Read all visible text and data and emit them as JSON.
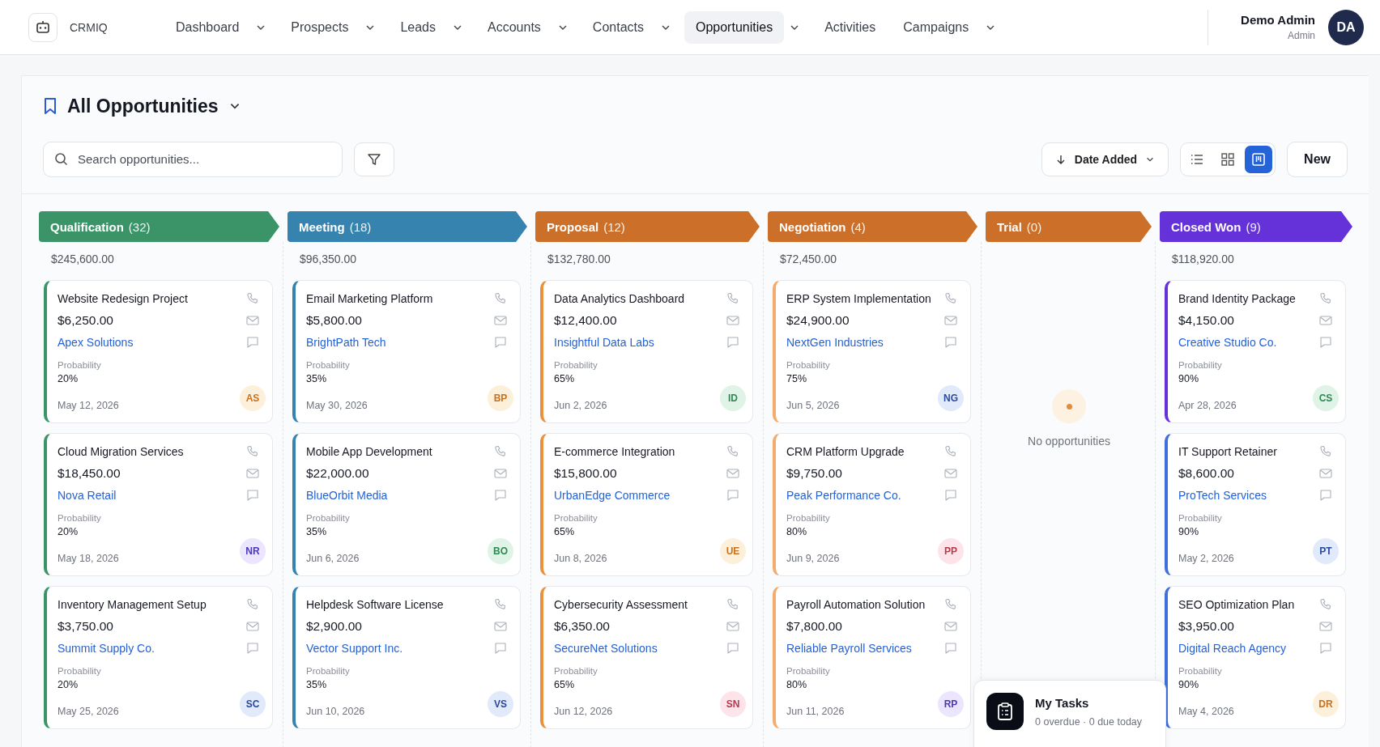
{
  "app": {
    "name": "CRMIQ"
  },
  "nav": [
    {
      "label": "Dashboard",
      "has_menu": true,
      "selected": false
    },
    {
      "label": "Prospects",
      "has_menu": true,
      "selected": false
    },
    {
      "label": "Leads",
      "has_menu": true,
      "selected": false
    },
    {
      "label": "Accounts",
      "has_menu": true,
      "selected": false
    },
    {
      "label": "Contacts",
      "has_menu": true,
      "selected": false
    },
    {
      "label": "Opportunities",
      "has_menu": true,
      "selected": true
    },
    {
      "label": "Activities",
      "has_menu": false,
      "selected": false
    },
    {
      "label": "Campaigns",
      "has_menu": true,
      "selected": false
    }
  ],
  "user": {
    "name": "Demo Admin",
    "role": "Admin",
    "initials": "DA"
  },
  "view_title": "All Opportunities",
  "search": {
    "placeholder": "Search opportunities..."
  },
  "sort": {
    "label": "Date Added"
  },
  "view_modes": [
    {
      "kind": "list",
      "selected": false
    },
    {
      "kind": "grid",
      "selected": false
    },
    {
      "kind": "kanban",
      "selected": true
    }
  ],
  "new_button": "New",
  "stages": [
    {
      "name": "Qualification",
      "count": "(32)",
      "color": "#3a9468",
      "total": "$245,600.00",
      "cards": [
        {
          "title": "Website Redesign Project",
          "amount": "$6,250.00",
          "company": "Apex Solutions",
          "probability_label": "Probability",
          "probability": "20%",
          "date": "May 12, 2026",
          "initials": "AS",
          "kind": "orange",
          "color": "#3a9468"
        },
        {
          "title": "Cloud Migration Services",
          "amount": "$18,450.00",
          "company": "Nova Retail",
          "probability_label": "Probability",
          "probability": "20%",
          "date": "May 18, 2026",
          "initials": "NR",
          "kind": "purple",
          "color": "#3a9468"
        },
        {
          "title": "Inventory Management Setup",
          "amount": "$3,750.00",
          "company": "Summit Supply Co.",
          "probability_label": "Probability",
          "probability": "20%",
          "date": "May 25, 2026",
          "initials": "SC",
          "kind": "blue",
          "color": "#3a9468"
        }
      ]
    },
    {
      "name": "Meeting",
      "count": "(18)",
      "color": "#3583ae",
      "total": "$96,350.00",
      "cards": [
        {
          "title": "Email Marketing Platform",
          "amount": "$5,800.00",
          "company": "BrightPath Tech",
          "probability_label": "Probability",
          "probability": "35%",
          "date": "May 30, 2026",
          "initials": "BP",
          "kind": "orange",
          "color": "#3583ae"
        },
        {
          "title": "Mobile App Development",
          "amount": "$22,000.00",
          "company": "BlueOrbit Media",
          "probability_label": "Probability",
          "probability": "35%",
          "date": "Jun 6, 2026",
          "initials": "BO",
          "kind": "green",
          "color": "#3583ae"
        },
        {
          "title": "Helpdesk Software License",
          "amount": "$2,900.00",
          "company": "Vector Support Inc.",
          "probability_label": "Probability",
          "probability": "35%",
          "date": "Jun 10, 2026",
          "initials": "VS",
          "kind": "blue",
          "color": "#3583ae"
        }
      ]
    },
    {
      "name": "Proposal",
      "count": "(12)",
      "color": "#cc6f28",
      "total": "$132,780.00",
      "cards": [
        {
          "title": "Data Analytics Dashboard",
          "amount": "$12,400.00",
          "company": "Insightful Data Labs",
          "probability_label": "Probability",
          "probability": "65%",
          "date": "Jun 2, 2026",
          "initials": "ID",
          "kind": "green",
          "color": "#e8913f"
        },
        {
          "title": "E-commerce Integration",
          "amount": "$15,800.00",
          "company": "UrbanEdge Commerce",
          "probability_label": "Probability",
          "probability": "65%",
          "date": "Jun 8, 2026",
          "initials": "UE",
          "kind": "orange",
          "color": "#e8913f"
        },
        {
          "title": "Cybersecurity Assessment",
          "amount": "$6,350.00",
          "company": "SecureNet Solutions",
          "probability_label": "Probability",
          "probability": "65%",
          "date": "Jun 12, 2026",
          "initials": "SN",
          "kind": "pink",
          "color": "#e8913f"
        }
      ]
    },
    {
      "name": "Negotiation",
      "count": "(4)",
      "color": "#cc6f28",
      "total": "$72,450.00",
      "cards": [
        {
          "title": "ERP System Implementation",
          "amount": "$24,900.00",
          "company": "NextGen Industries",
          "probability_label": "Probability",
          "probability": "75%",
          "date": "Jun 5, 2026",
          "initials": "NG",
          "kind": "blue",
          "color": "#f4ac6c"
        },
        {
          "title": "CRM Platform Upgrade",
          "amount": "$9,750.00",
          "company": "Peak Performance Co.",
          "probability_label": "Probability",
          "probability": "80%",
          "date": "Jun 9, 2026",
          "initials": "PP",
          "kind": "pink",
          "color": "#f4ac6c"
        },
        {
          "title": "Payroll Automation Solution",
          "amount": "$7,800.00",
          "company": "Reliable Payroll Services",
          "probability_label": "Probability",
          "probability": "80%",
          "date": "Jun 11, 2026",
          "initials": "RP",
          "kind": "purple",
          "color": "#f4ac6c"
        }
      ]
    },
    {
      "name": "Trial",
      "count": "(0)",
      "color": "#cc6f28",
      "empty_text": "No opportunities"
    },
    {
      "name": "Closed Won",
      "count": "(9)",
      "color": "#6532d9",
      "total": "$118,920.00",
      "cards": [
        {
          "title": "Brand Identity Package",
          "amount": "$4,150.00",
          "company": "Creative Studio Co.",
          "probability_label": "Probability",
          "probability": "90%",
          "date": "Apr 28, 2026",
          "initials": "CS",
          "kind": "green",
          "color": "#6532d9"
        },
        {
          "title": "IT Support Retainer",
          "amount": "$8,600.00",
          "company": "ProTech Services",
          "probability_label": "Probability",
          "probability": "90%",
          "date": "May 2, 2026",
          "initials": "PT",
          "kind": "blue",
          "color": "#3f6fdc"
        },
        {
          "title": "SEO Optimization Plan",
          "amount": "$3,950.00",
          "company": "Digital Reach Agency",
          "probability_label": "Probability",
          "probability": "90%",
          "date": "May 4, 2026",
          "initials": "DR",
          "kind": "orange",
          "color": "#3f6fdc"
        }
      ]
    }
  ],
  "tasks": {
    "title": "My Tasks",
    "summary": "0 overdue · 0 due today"
  }
}
